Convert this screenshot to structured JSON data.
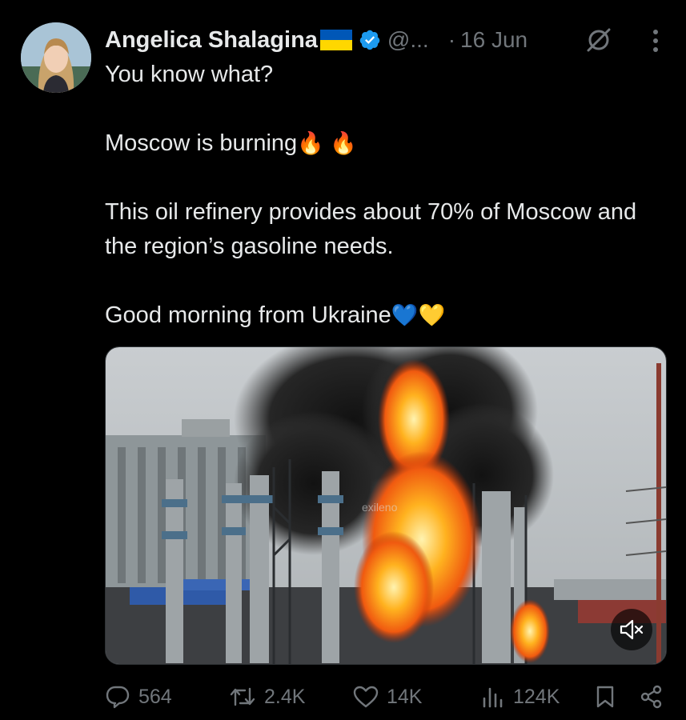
{
  "tweet": {
    "author_name": "Angelica Shalagina",
    "handle": "@...",
    "separator": "·",
    "date": "16 Jun",
    "text_line1": "You know what?",
    "text_line2": "Moscow is burning",
    "text_line2_emoji": "🔥 🔥",
    "text_line3": "This oil refinery provides about 70% of Moscow and the region’s gasoline needs.",
    "text_line4": "Good morning from Ukraine",
    "text_line4_emoji": "💙💛",
    "media_watermark": "exileno"
  },
  "actions": {
    "replies": "564",
    "reposts": "2.4K",
    "likes": "14K",
    "views": "124K"
  },
  "icons": {
    "avatar": "profile-photo",
    "flag": "ukraine-flag",
    "verified": "verified-badge",
    "grok": "grok-icon",
    "more": "more-icon",
    "reply": "reply-icon",
    "repost": "repost-icon",
    "like": "heart-icon",
    "views": "views-icon",
    "bookmark": "bookmark-icon",
    "share": "share-icon",
    "mute": "mute-icon"
  },
  "colors": {
    "background": "#000000",
    "text": "#e7e9ea",
    "secondary": "#71767b",
    "verified": "#1d9bf0",
    "flag_blue": "#0057b7",
    "flag_yellow": "#ffd700"
  }
}
